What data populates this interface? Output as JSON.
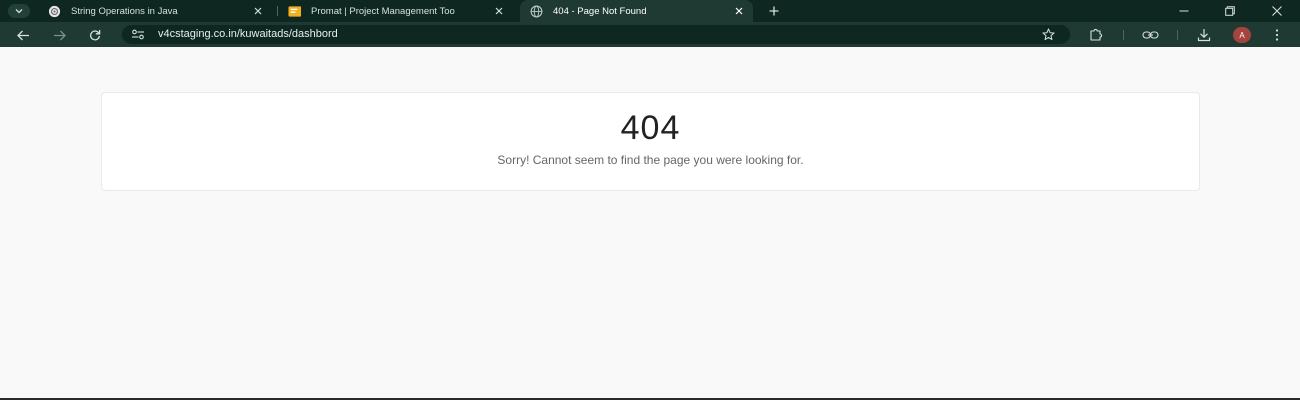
{
  "browser": {
    "tabs": [
      {
        "title": "String Operations in Java",
        "active": false
      },
      {
        "title": "Promat | Project Management Too",
        "active": false
      },
      {
        "title": "404 - Page Not Found",
        "active": true
      }
    ],
    "address": {
      "url": "v4cstaging.co.in/kuwaitads/dashbord"
    },
    "profile": {
      "initial": "A",
      "color": "#a4443c"
    },
    "theme": {
      "frame": "#0e2721",
      "toolbar": "#1e3a33"
    }
  },
  "page": {
    "error_code": "404",
    "message": "Sorry! Cannot seem to find the page you were looking for."
  }
}
